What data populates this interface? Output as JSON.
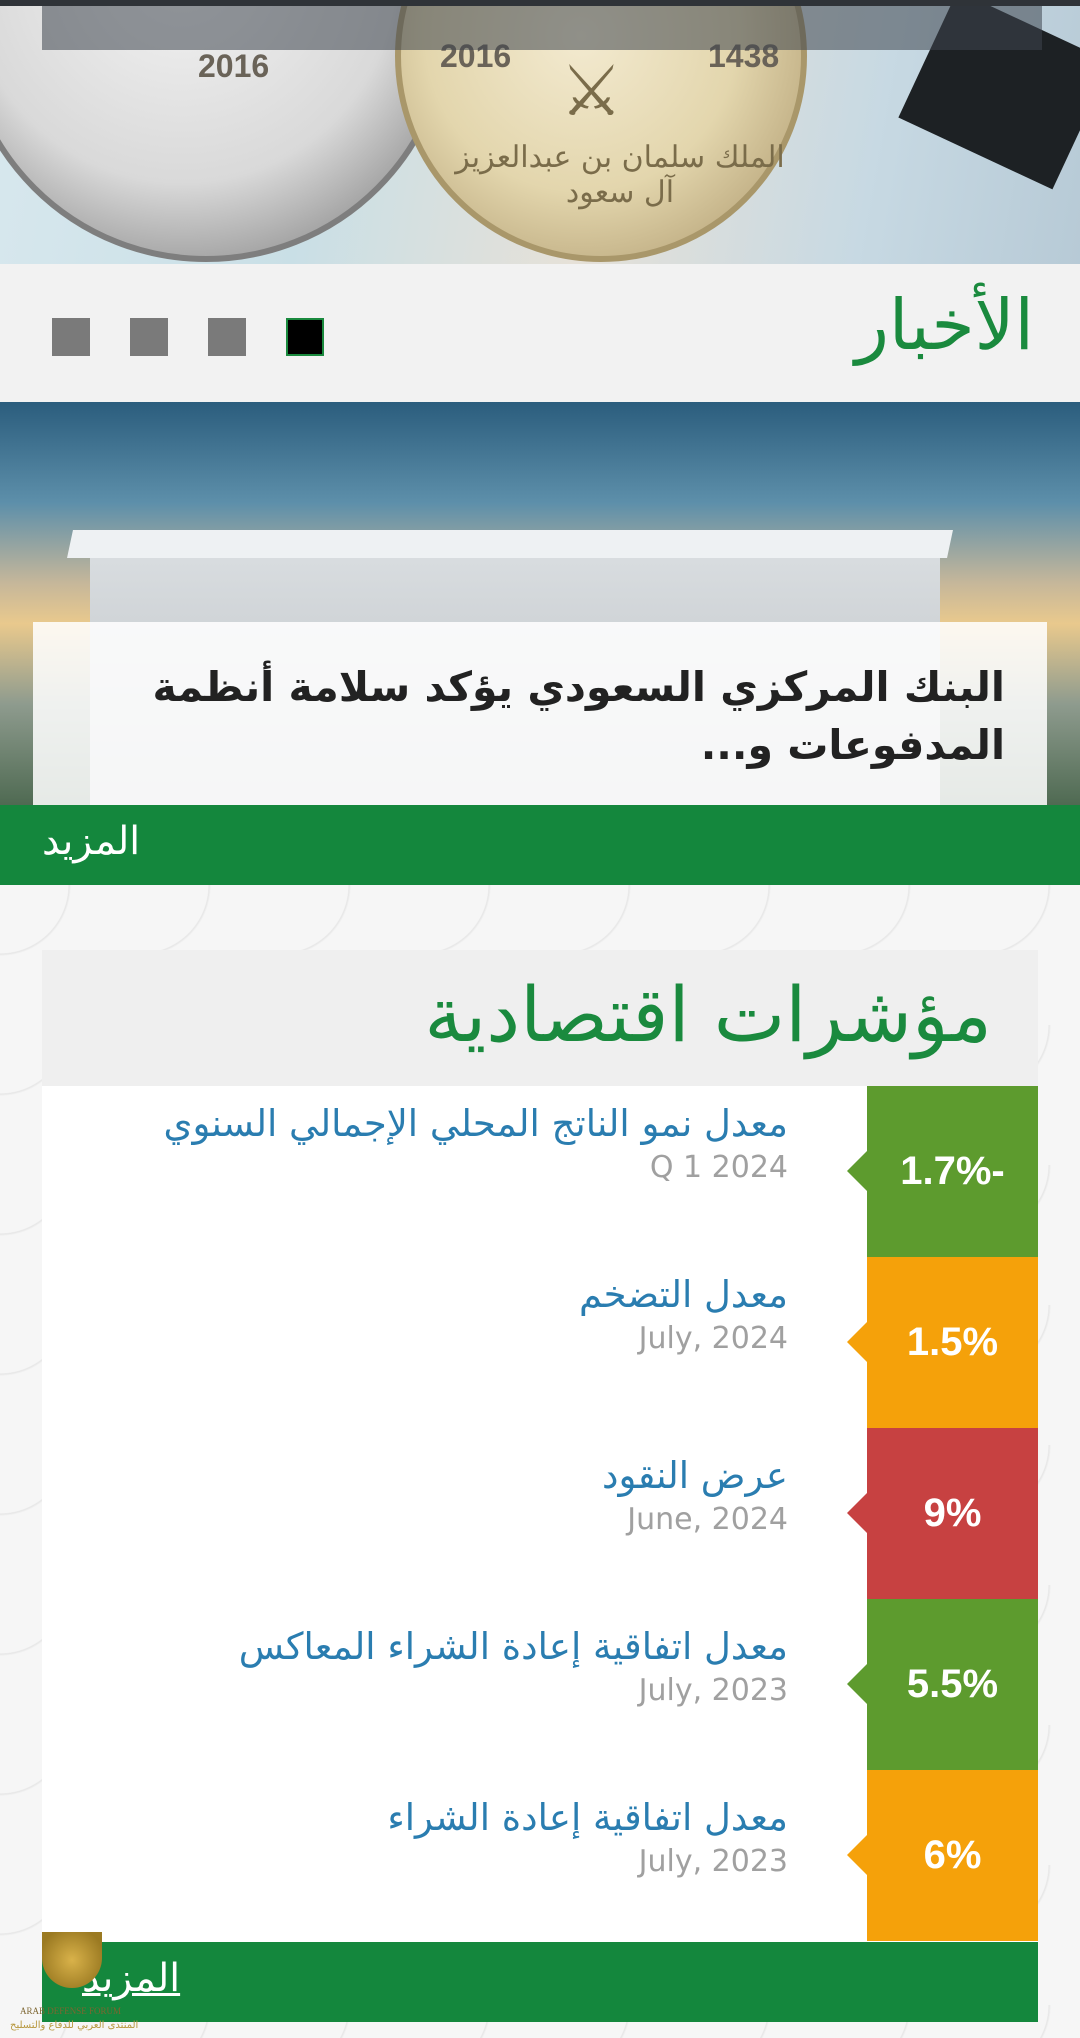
{
  "hero": {
    "coin_year_left": "2016",
    "coin_year_right": "2016",
    "coin_hijri": "1438",
    "coin_inscription": "الملك سلمان بن عبدالعزيز آل سعود"
  },
  "news": {
    "title": "الأخبار",
    "slides_count": 4,
    "active_slide": 1,
    "headline": "البنك المركزي السعودي يؤكد سلامة أنظمة المدفوعات و...",
    "more_label": "المزيد"
  },
  "indicators": {
    "title": "مؤشرات اقتصادية",
    "items": [
      {
        "name": "معدل نمو الناتج المحلي الإجمالي السنوي",
        "date": "Q 1 2024",
        "value": "1.7%-",
        "color": "#5d9b2e"
      },
      {
        "name": "معدل التضخم",
        "date": "July, 2024",
        "value": "1.5%",
        "color": "#f5a10a"
      },
      {
        "name": "عرض النقود",
        "date": "June, 2024",
        "value": "9%",
        "color": "#c74141"
      },
      {
        "name": "معدل اتفاقية إعادة الشراء المعاكس",
        "date": "July, 2023",
        "value": "5.5%",
        "color": "#5d9b2e"
      },
      {
        "name": "معدل اتفاقية إعادة الشراء",
        "date": "July, 2023",
        "value": "6%",
        "color": "#f5a10a"
      }
    ],
    "more_label": "المزيد"
  },
  "watermark": {
    "line1": "ARAB DEFENSE FORUM",
    "line2": "المنتدى العربي للدفاع والتسليح"
  }
}
